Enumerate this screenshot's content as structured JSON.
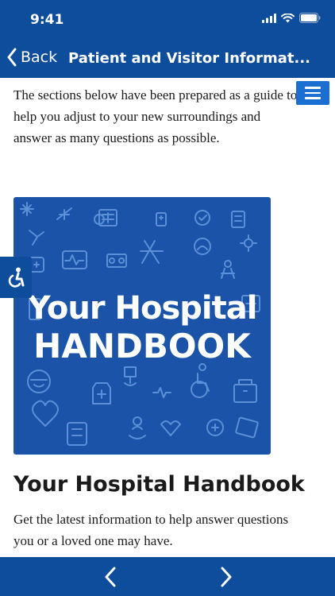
{
  "status_bar": {
    "time": "9:41"
  },
  "nav": {
    "back_label": "Back",
    "title": "Patient and Visitor Informat..."
  },
  "content": {
    "intro_text": "The sections below have been prepared as a guide to help you adjust to your new surroundings and answer as many questions as possible.",
    "image": {
      "line1": "Your Hospital",
      "line2": "HANDBOOK"
    },
    "section_heading": "Your Hospital Handbook",
    "section_text": "Get the latest information to help answer questions you or a loved one may have."
  },
  "colors": {
    "primary": "#0d4d9b",
    "menu_button": "#1a6fd0",
    "image_bg": "#1a53a8",
    "icon_line": "#5b8fd6"
  },
  "icons": {
    "back": "chevron-left-icon",
    "menu": "hamburger-menu-icon",
    "accessibility": "wheelchair-accessibility-icon",
    "prev": "chevron-left-icon",
    "next": "chevron-right-icon"
  }
}
